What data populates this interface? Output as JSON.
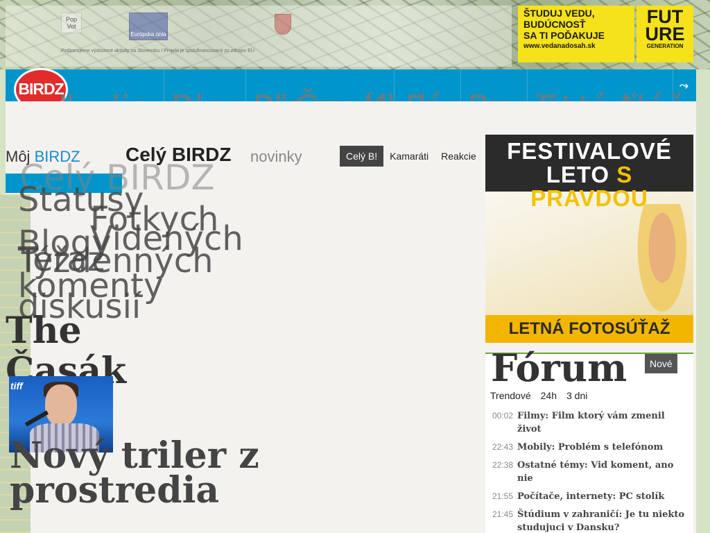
{
  "top_banner": {
    "pop_logo_text": "Pop Vot",
    "eu_label": "Európska únia",
    "sponsor_text": "Podporujeme výskumné aktivity na Slovensku / Projekt je spolufinancovaný zo zdrojov EÚ",
    "ad_lines": [
      "ŠTUDUJ VEDU,",
      "BUDÚCNOSŤ",
      "SA TI POĎAKUJE"
    ],
    "ad_url": "www.vedanadosah.sk",
    "future_lines": [
      "FUT",
      "URE"
    ],
    "future_sub": "GENERATION"
  },
  "nav": {
    "logo": "BIRDZ",
    "items": [
      "Ľudia",
      "Blogy",
      "Pľaca",
      "Časák",
      "Kluby",
      "Fórum",
      "Registrácia",
      "Foto",
      "Náš"
    ],
    "icon": "share-icon"
  },
  "main": {
    "my_prefix": "Môj",
    "my_brand": "BIRDZ",
    "title": "Celý BIRDZ",
    "subtitle": "novinky",
    "tabs": [
      "Celý B!",
      "Kamaráti",
      "Reakcie"
    ],
    "side_title": "Celý BIRDZ",
    "side_categories": [
      "Statusy",
      "Fotkych",
      "Videných",
      "Blogy",
      "Teraz",
      "Týždenných",
      "komenty",
      "diskusií"
    ],
    "casak_title": "The Časák",
    "article_title": "Nový triler z prostredia"
  },
  "right": {
    "ad_head_1": "FESTIVALOVÉ",
    "ad_head_2a": "LETO",
    "ad_head_2b": "S PRAVDOU",
    "ad_foot": "LETNÁ FOTOSÚŤAŽ",
    "forum_title": "Fórum",
    "forum_new": "Nové",
    "forum_tabs": [
      "Trendové",
      "24h",
      "3 dni"
    ],
    "forum_items": [
      {
        "time": "00:02",
        "text": "Filmy: Film ktorý vám zmenil život"
      },
      {
        "time": "22:43",
        "text": "Mobily: Problém s telefónom"
      },
      {
        "time": "22:38",
        "text": "Ostatné témy: Vid koment, ano nie"
      },
      {
        "time": "21:55",
        "text": "Počítače, internety: PC stolík"
      },
      {
        "time": "21:45",
        "text": "Štúdium v zahraničí: Je tu niekto studujuci v Dansku?"
      }
    ]
  },
  "colors": {
    "nav_blue": "#0096cc",
    "logo_red": "#e22b2b",
    "ad_yellow": "#f5e21a",
    "forum_green": "#6aa82f"
  }
}
